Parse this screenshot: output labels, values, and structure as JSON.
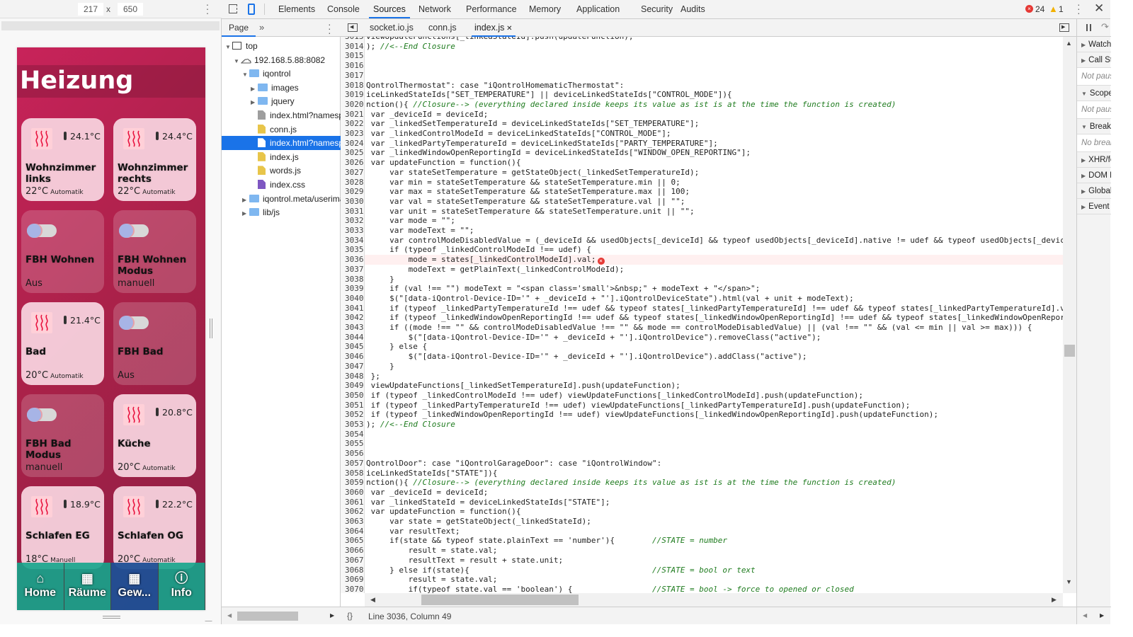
{
  "device_toolbar": {
    "width": "217",
    "height": "650",
    "separator": "x"
  },
  "app": {
    "title": "Heizung",
    "tiles": [
      {
        "name": "Wohnzimmer links",
        "icon": "heating-icon",
        "temp": "24.1°C",
        "set": "22°C",
        "mode": "Automatik",
        "active": true
      },
      {
        "name": "Wohnzimmer rechts",
        "icon": "heating-icon",
        "temp": "24.4°C",
        "set": "22°C",
        "mode": "Automatik",
        "active": true
      },
      {
        "name": "FBH Wohnen",
        "icon": "toggle-icon",
        "status": "Aus",
        "active": false
      },
      {
        "name": "FBH Wohnen Modus",
        "icon": "toggle-icon",
        "status": "manuell",
        "active": false
      },
      {
        "name": "Bad",
        "icon": "heating-icon",
        "temp": "21.4°C",
        "set": "20°C",
        "mode": "Automatik",
        "active": true
      },
      {
        "name": "FBH Bad",
        "icon": "toggle-icon",
        "status": "Aus",
        "active": false
      },
      {
        "name": "FBH Bad Modus",
        "icon": "toggle-icon",
        "status": "manuell",
        "active": false
      },
      {
        "name": "Küche",
        "icon": "heating-icon",
        "temp": "20.8°C",
        "set": "20°C",
        "mode": "Automatik",
        "active": true
      },
      {
        "name": "Schlafen EG",
        "icon": "heating-icon",
        "temp": "18.9°C",
        "set": "18°C",
        "mode": "Manuell",
        "active": true
      },
      {
        "name": "Schlafen OG",
        "icon": "heating-icon",
        "temp": "22.2°C",
        "set": "20°C",
        "mode": "Automatik",
        "active": true
      }
    ],
    "nav": [
      {
        "label": "Home",
        "icon": "home-icon"
      },
      {
        "label": "Räume",
        "icon": "grid-icon"
      },
      {
        "label": "Gew...",
        "icon": "grid-icon",
        "active": true
      },
      {
        "label": "Info",
        "icon": "info-icon"
      }
    ],
    "colors": {
      "header": "#c8235a",
      "nav": "#14a58c",
      "nav_active": "#1e5096"
    }
  },
  "devtools": {
    "tabs": [
      "Elements",
      "Console",
      "Sources",
      "Network",
      "Performance",
      "Memory",
      "Application",
      "Security",
      "Audits"
    ],
    "active_tab": "Sources",
    "errors": "24",
    "warnings": "1",
    "navigator": {
      "tab": "Page",
      "more": "»",
      "tree": [
        {
          "label": "top",
          "type": "frame",
          "depth": 0,
          "open": true
        },
        {
          "label": "192.168.5.88:8082",
          "type": "cloud",
          "depth": 1,
          "open": true
        },
        {
          "label": "iqontrol",
          "type": "folder",
          "depth": 2,
          "open": true
        },
        {
          "label": "images",
          "type": "folder",
          "depth": 3,
          "open": false
        },
        {
          "label": "jquery",
          "type": "folder",
          "depth": 3,
          "open": false
        },
        {
          "label": "index.html?namespace",
          "type": "file-gray",
          "depth": 3
        },
        {
          "label": "conn.js",
          "type": "file-js",
          "depth": 3
        },
        {
          "label": "index.html?namespace",
          "type": "file-white",
          "depth": 3,
          "selected": true
        },
        {
          "label": "index.js",
          "type": "file-js",
          "depth": 3
        },
        {
          "label": "words.js",
          "type": "file-js",
          "depth": 3
        },
        {
          "label": "index.css",
          "type": "file-css",
          "depth": 3
        },
        {
          "label": "iqontrol.meta/userimages",
          "type": "folder",
          "depth": 2,
          "open": false
        },
        {
          "label": "lib/js",
          "type": "folder",
          "depth": 2,
          "open": false
        }
      ]
    },
    "editor_tabs": [
      {
        "label": "socket.io.js"
      },
      {
        "label": "conn.js"
      },
      {
        "label": "index.js",
        "active": true,
        "closable": true
      }
    ],
    "code": {
      "first_line": 3013,
      "error_line": 3036,
      "lines": [
        "viewUpdateFunctions[_linkedStateId].push(updateFunction);",
        "); //<--End Closure",
        "",
        "",
        "",
        "QontrolThermostat\": case \"iQontrolHomematicThermostat\":",
        "iceLinkedStateIds[\"SET_TEMPERATURE\"] || deviceLinkedStateIds[\"CONTROL_MODE\"]){",
        "nction(){ //Closure--> (everything declared inside keeps its value as ist is at the time the function is created)",
        " var _deviceId = deviceId;",
        " var _linkedSetTemperatureId = deviceLinkedStateIds[\"SET_TEMPERATURE\"];",
        " var _linkedControlModeId = deviceLinkedStateIds[\"CONTROL_MODE\"];",
        " var _linkedPartyTemperatureId = deviceLinkedStateIds[\"PARTY_TEMPERATURE\"];",
        " var _linkedWindowOpenReportingId = deviceLinkedStateIds[\"WINDOW_OPEN_REPORTING\"];",
        " var updateFunction = function(){",
        "     var stateSetTemperature = getStateObject(_linkedSetTemperatureId);",
        "     var min = stateSetTemperature && stateSetTemperature.min || 0;",
        "     var max = stateSetTemperature && stateSetTemperature.max || 100;",
        "     var val = stateSetTemperature && stateSetTemperature.val || \"\";",
        "     var unit = stateSetTemperature && stateSetTemperature.unit || \"\";",
        "     var mode = \"\";",
        "     var modeText = \"\";",
        "     var controlModeDisabledValue = (_deviceId && usedObjects[_deviceId] && typeof usedObjects[_deviceId].native != udef && typeof usedObjects[_deviceId",
        "     if (typeof _linkedControlModeId !== udef) {",
        "         mode = states[_linkedControlModeId].val;",
        "         modeText = getPlainText(_linkedControlModeId);",
        "     }",
        "     if (val !== \"\") modeText = \"<span class='small'>&nbsp;\" + modeText + \"</span>\";",
        "     $(\"[data-iQontrol-Device-ID='\" + _deviceId + \"'].iQontrolDeviceState\").html(val + unit + modeText);",
        "     if (typeof _linkedPartyTemperatureId !== udef && typeof states[_linkedPartyTemperatureId] !== udef && typeof states[_linkedPartyTemperatureId].val",
        "     if (typeof _linkedWindowOpenReportingId !== udef && typeof states[_linkedWindowOpenReportingId] !== udef && typeof states[_linkedWindowOpenReportin",
        "     if ((mode !== \"\" && controlModeDisabledValue !== \"\" && mode == controlModeDisabledValue) || (val !== \"\" && (val <= min || val >= max))) {",
        "         $(\"[data-iQontrol-Device-ID='\" + _deviceId + \"'].iQontrolDevice\").removeClass(\"active\");",
        "     } else {",
        "         $(\"[data-iQontrol-Device-ID='\" + _deviceId + \"'].iQontrolDevice\").addClass(\"active\");",
        "     }",
        " };",
        " viewUpdateFunctions[_linkedSetTemperatureId].push(updateFunction);",
        " if (typeof _linkedControlModeId !== udef) viewUpdateFunctions[_linkedControlModeId].push(updateFunction);",
        " if (typeof _linkedPartyTemperatureId !== udef) viewUpdateFunctions[_linkedPartyTemperatureId].push(updateFunction);",
        " if (typeof _linkedWindowOpenReportingId !== udef) viewUpdateFunctions[_linkedWindowOpenReportingId].push(updateFunction);",
        "); //<--End Closure",
        "",
        "",
        "",
        "QontrolDoor\": case \"iQontrolGarageDoor\": case \"iQontrolWindow\":",
        "iceLinkedStateIds[\"STATE\"]){",
        "nction(){ //Closure--> (everything declared inside keeps its value as ist is at the time the function is created)",
        " var _deviceId = deviceId;",
        " var _linkedStateId = deviceLinkedStateIds[\"STATE\"];",
        " var updateFunction = function(){",
        "     var state = getStateObject(_linkedStateId);",
        "     var resultText;",
        "     if(state && typeof state.plainText == 'number'){        //STATE = number",
        "         result = state.val;",
        "         resultText = result + state.unit;",
        "     } else if(state){                                       //STATE = bool or text",
        "         result = state.val;",
        "         if(typeof state.val == 'boolean') {                 //STATE = bool -> force to opened or closed",
        ""
      ]
    },
    "status": "Line 3036, Column 49",
    "sidebar": [
      {
        "label": "Watch",
        "open": false
      },
      {
        "label": "Call Stack",
        "open": false
      },
      {
        "label": "Not paused",
        "italic": true
      },
      {
        "label": "Scope",
        "open": true
      },
      {
        "label": "Not paused",
        "italic": true
      },
      {
        "label": "Breakpoints",
        "open": true
      },
      {
        "label": "No breakpoints",
        "italic": true
      },
      {
        "label": "XHR/fetch Breakpoints",
        "open": false
      },
      {
        "label": "DOM Breakpoints",
        "open": false
      },
      {
        "label": "Global Listeners",
        "open": false
      },
      {
        "label": "Event Listener Breakpoints",
        "open": false
      }
    ]
  }
}
